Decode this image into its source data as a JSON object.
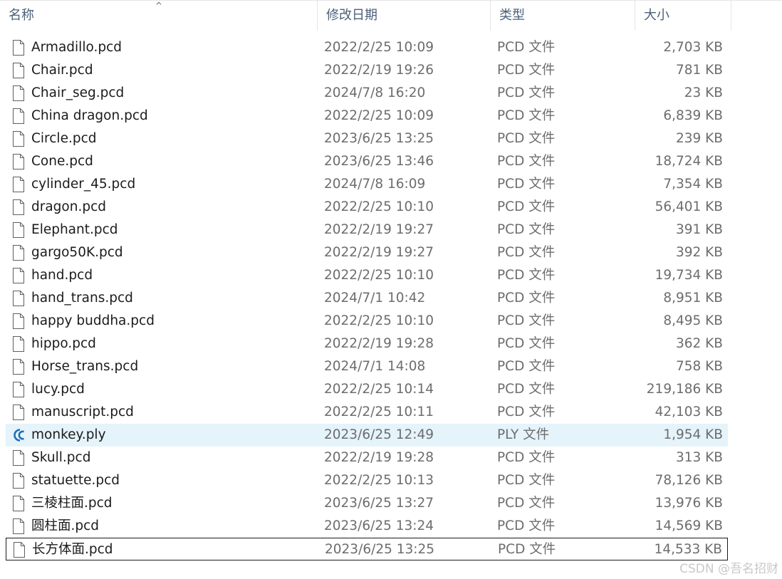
{
  "columns": {
    "name": "名称",
    "date": "修改日期",
    "type": "类型",
    "size": "大小"
  },
  "files": [
    {
      "name": "Armadillo.pcd",
      "date": "2022/2/25 10:09",
      "type": "PCD 文件",
      "size": "2,703 KB",
      "icon": "file-icon"
    },
    {
      "name": "Chair.pcd",
      "date": "2022/2/19 19:26",
      "type": "PCD 文件",
      "size": "781 KB",
      "icon": "file-icon"
    },
    {
      "name": "Chair_seg.pcd",
      "date": "2024/7/8 16:20",
      "type": "PCD 文件",
      "size": "23 KB",
      "icon": "file-icon"
    },
    {
      "name": "China dragon.pcd",
      "date": "2022/2/25 10:09",
      "type": "PCD 文件",
      "size": "6,839 KB",
      "icon": "file-icon"
    },
    {
      "name": "Circle.pcd",
      "date": "2023/6/25 13:25",
      "type": "PCD 文件",
      "size": "239 KB",
      "icon": "file-icon"
    },
    {
      "name": "Cone.pcd",
      "date": "2023/6/25 13:46",
      "type": "PCD 文件",
      "size": "18,724 KB",
      "icon": "file-icon"
    },
    {
      "name": "cylinder_45.pcd",
      "date": "2024/7/8 16:09",
      "type": "PCD 文件",
      "size": "7,354 KB",
      "icon": "file-icon"
    },
    {
      "name": "dragon.pcd",
      "date": "2022/2/25 10:10",
      "type": "PCD 文件",
      "size": "56,401 KB",
      "icon": "file-icon"
    },
    {
      "name": "Elephant.pcd",
      "date": "2022/2/19 19:27",
      "type": "PCD 文件",
      "size": "391 KB",
      "icon": "file-icon"
    },
    {
      "name": "gargo50K.pcd",
      "date": "2022/2/19 19:27",
      "type": "PCD 文件",
      "size": "392 KB",
      "icon": "file-icon"
    },
    {
      "name": "hand.pcd",
      "date": "2022/2/25 10:10",
      "type": "PCD 文件",
      "size": "19,734 KB",
      "icon": "file-icon"
    },
    {
      "name": "hand_trans.pcd",
      "date": "2024/7/1 10:42",
      "type": "PCD 文件",
      "size": "8,951 KB",
      "icon": "file-icon"
    },
    {
      "name": "happy buddha.pcd",
      "date": "2022/2/25 10:10",
      "type": "PCD 文件",
      "size": "8,495 KB",
      "icon": "file-icon"
    },
    {
      "name": "hippo.pcd",
      "date": "2022/2/19 19:28",
      "type": "PCD 文件",
      "size": "362 KB",
      "icon": "file-icon"
    },
    {
      "name": "Horse_trans.pcd",
      "date": "2024/7/1 14:08",
      "type": "PCD 文件",
      "size": "758 KB",
      "icon": "file-icon"
    },
    {
      "name": "lucy.pcd",
      "date": "2022/2/25 10:14",
      "type": "PCD 文件",
      "size": "219,186 KB",
      "icon": "file-icon"
    },
    {
      "name": "manuscript.pcd",
      "date": "2022/2/25 10:11",
      "type": "PCD 文件",
      "size": "42,103 KB",
      "icon": "file-icon"
    },
    {
      "name": "monkey.ply",
      "date": "2023/6/25 12:49",
      "type": "PLY 文件",
      "size": "1,954 KB",
      "icon": "cloudcompare-icon",
      "selected": true
    },
    {
      "name": "Skull.pcd",
      "date": "2022/2/19 19:28",
      "type": "PCD 文件",
      "size": "313 KB",
      "icon": "file-icon"
    },
    {
      "name": "statuette.pcd",
      "date": "2022/2/25 10:13",
      "type": "PCD 文件",
      "size": "78,126 KB",
      "icon": "file-icon"
    },
    {
      "name": "三棱柱面.pcd",
      "date": "2023/6/25 13:27",
      "type": "PCD 文件",
      "size": "13,976 KB",
      "icon": "file-icon"
    },
    {
      "name": "圆柱面.pcd",
      "date": "2023/6/25 13:24",
      "type": "PCD 文件",
      "size": "14,569 KB",
      "icon": "file-icon"
    },
    {
      "name": "长方体面.pcd",
      "date": "2023/6/25 13:25",
      "type": "PCD 文件",
      "size": "14,533 KB",
      "icon": "file-icon",
      "focused": true
    }
  ],
  "watermark": "CSDN @吾名招财"
}
